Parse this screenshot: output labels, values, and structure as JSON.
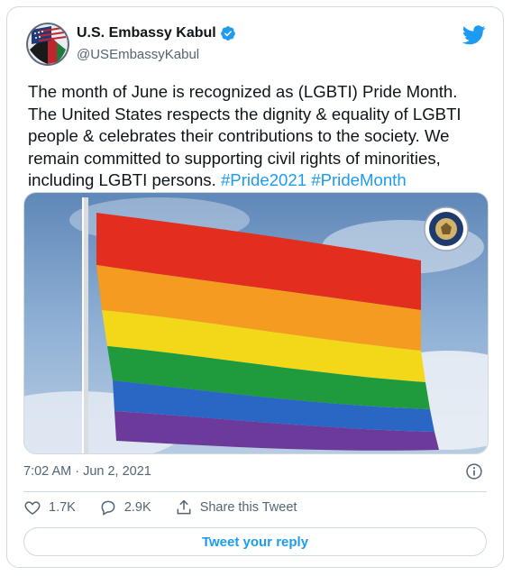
{
  "account": {
    "display_name": "U.S. Embassy Kabul",
    "handle": "@USEmbassyKabul"
  },
  "tweet": {
    "text": "The month of June is recognized as (LGBTI) Pride Month. The United States respects the dignity & equality of LGBTI people & celebrates their contributions to the society. We remain committed to supporting civil rights of minorities, including LGBTI persons.",
    "hashtags": [
      "#Pride2021",
      "#PrideMonth"
    ],
    "timestamp": "7:02 AM · Jun 2, 2021"
  },
  "actions": {
    "likes": "1.7K",
    "replies": "2.9K",
    "share_label": "Share this Tweet"
  },
  "reply_button": {
    "label": "Tweet your reply"
  },
  "colors": {
    "accent": "#1d9bf0",
    "text": "#0f1419",
    "muted": "#536471",
    "border": "#cfd9de"
  },
  "icons": [
    "verified-badge-icon",
    "twitter-bird-icon",
    "info-icon",
    "heart-icon",
    "reply-icon",
    "share-icon"
  ]
}
